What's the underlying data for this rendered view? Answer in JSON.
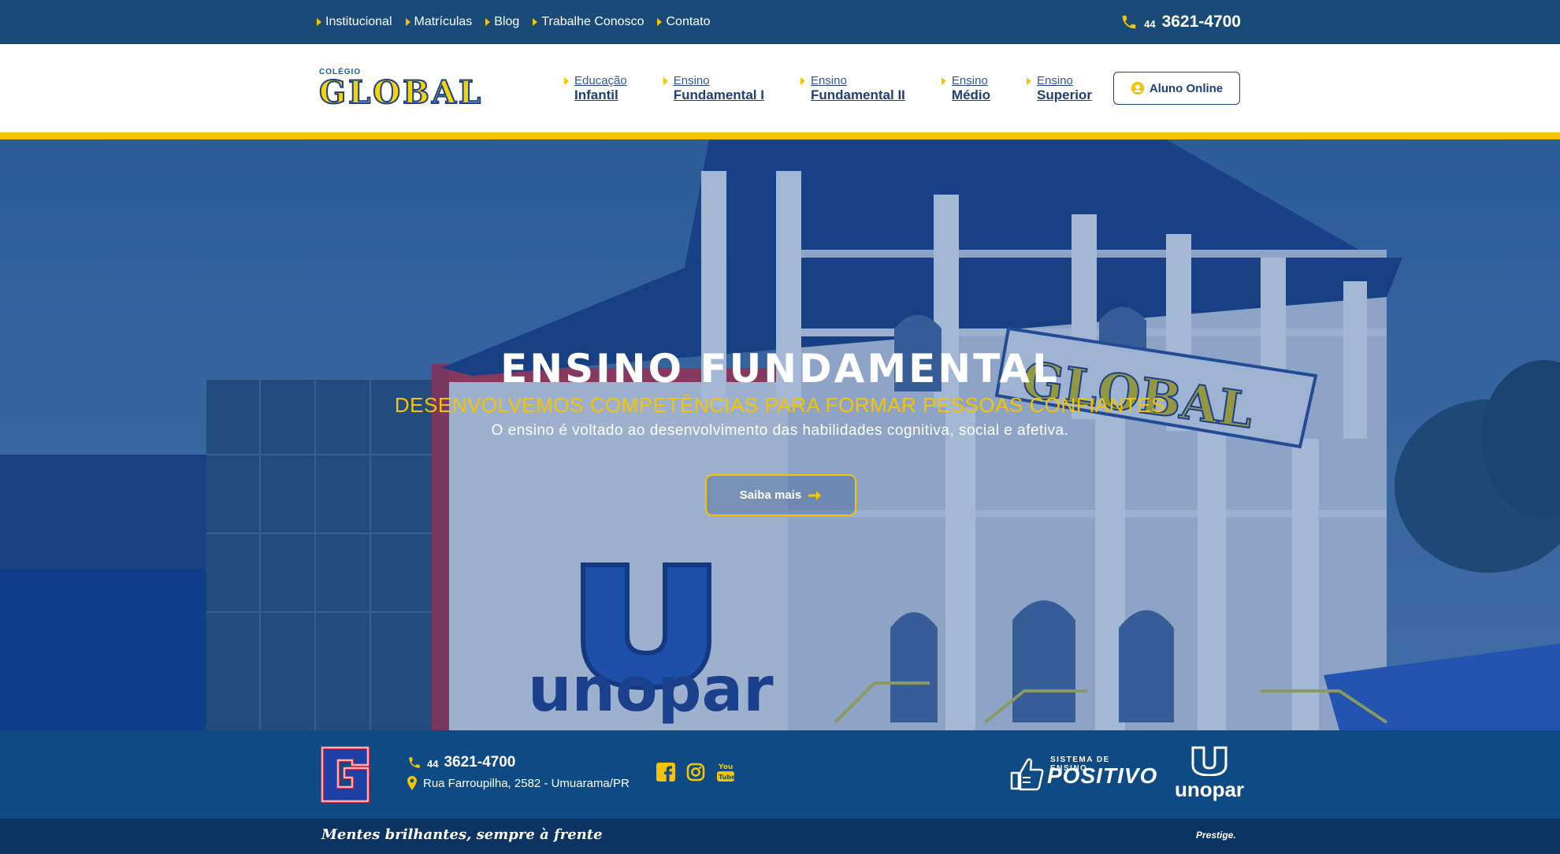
{
  "topbar": {
    "links": [
      "Institucional",
      "Matrículas",
      "Blog",
      "Trabalhe Conosco",
      "Contato"
    ],
    "phone_ddd": "44",
    "phone_number": "3621-4700"
  },
  "header": {
    "logo_small": "COLÉGIO",
    "logo_big": "GLOBAL",
    "nav": [
      {
        "line1": "Educação",
        "line2": "Infantil"
      },
      {
        "line1": "Ensino",
        "line2": "Fundamental I"
      },
      {
        "line1": "Ensino",
        "line2": "Fundamental II"
      },
      {
        "line1": "Ensino",
        "line2": "Médio"
      },
      {
        "line1": "Ensino",
        "line2": "Superior"
      }
    ],
    "aluno_online": "Aluno Online"
  },
  "hero": {
    "title": "ENSINO FUNDAMENTAL",
    "subtitle": "DESENVOLVEMOS COMPETÊNCIAS PARA FORMAR PESSOAS CONFIANTES",
    "description": "O ensino é voltado ao desenvolvimento das habilidades cognitiva, social e afetiva.",
    "button": "Saiba mais",
    "building_sign": "GLOBAL",
    "unopar_sign": "unopar"
  },
  "footer": {
    "phone_ddd": "44",
    "phone_number": "3621-4700",
    "address": "Rua Farroupilha, 2582 - Umuarama/PR",
    "social": [
      "facebook-icon",
      "instagram-icon",
      "youtube-icon"
    ],
    "positivo_small": "SISTEMA DE ENSINO",
    "positivo_big": "POSITIVO",
    "unopar": "unopar",
    "motto": "Mentes brilhantes, sempre à frente",
    "credit": "Prestige."
  },
  "colors": {
    "navy": "#1a4b78",
    "yellow": "#f5c400",
    "footer": "#0e4a84",
    "bottombar": "#0b3462"
  }
}
